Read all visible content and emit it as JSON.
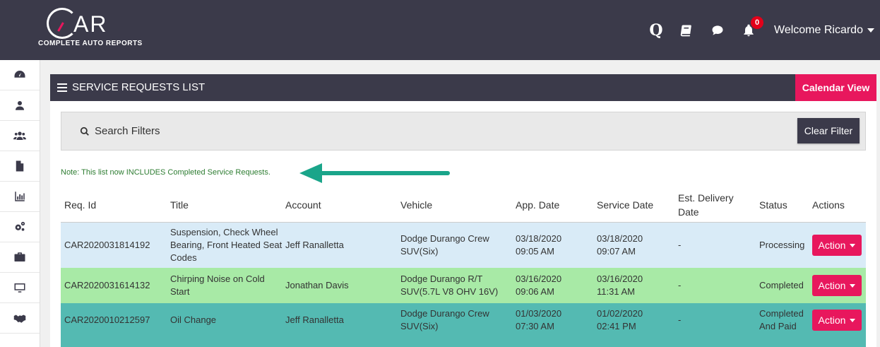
{
  "brand": {
    "name": "AR",
    "tagline": "COMPLETE AUTO REPORTS"
  },
  "header": {
    "q_label": "Q",
    "notification_count": "0",
    "welcome": "Welcome Ricardo"
  },
  "panel": {
    "title": "SERVICE REQUESTS LIST",
    "calendar_view": "Calendar View",
    "search_filters": "Search Filters",
    "clear_filter": "Clear Filter",
    "note": "Note: This list now INCLUDES Completed Service Requests."
  },
  "table": {
    "columns": [
      "Req. Id",
      "Title",
      "Account",
      "Vehicle",
      "App. Date",
      "Service Date",
      "Est. Delivery Date",
      "Status",
      "Actions"
    ],
    "action_label": "Action",
    "rows": [
      {
        "id": "CAR2020031814192",
        "title": "Suspension, Check Wheel Bearing, Front Heated Seat Codes",
        "account": "Jeff Ranalletta",
        "vehicle": "Dodge Durango Crew SUV(Six)",
        "app_date": "03/18/2020 09:05 AM",
        "service_date": "03/18/2020 09:07 AM",
        "est_delivery": "-",
        "status": "Processing"
      },
      {
        "id": "CAR2020031614132",
        "title": "Chirping Noise on Cold Start",
        "account": "Jonathan Davis",
        "vehicle": "Dodge Durango R/T SUV(5.7L V8 OHV 16V)",
        "app_date": "03/16/2020 09:06 AM",
        "service_date": "03/16/2020 11:31 AM",
        "est_delivery": "-",
        "status": "Completed"
      },
      {
        "id": "CAR2020010212597",
        "title": "Oil Change",
        "account": "Jeff Ranalletta",
        "vehicle": "Dodge Durango Crew SUV(Six)",
        "app_date": "01/03/2020 07:30 AM",
        "service_date": "01/02/2020 02:41 PM",
        "est_delivery": "-",
        "status": "Completed And Paid"
      }
    ]
  },
  "colors": {
    "header_bg": "#3b3a4a",
    "accent": "#e8175d",
    "row_processing": "#d9ebf7",
    "row_completed": "#a8eaa6",
    "row_paid": "#54bab2",
    "note_arrow": "#1aa58a"
  },
  "icons": {
    "header": [
      "q-icon",
      "book-icon",
      "chat-icon",
      "bell-icon"
    ],
    "sidebar": [
      "dashboard-icon",
      "user-icon",
      "users-icon",
      "document-icon",
      "chart-icon",
      "cogs-icon",
      "briefcase-icon",
      "monitor-icon",
      "handshake-icon"
    ]
  }
}
